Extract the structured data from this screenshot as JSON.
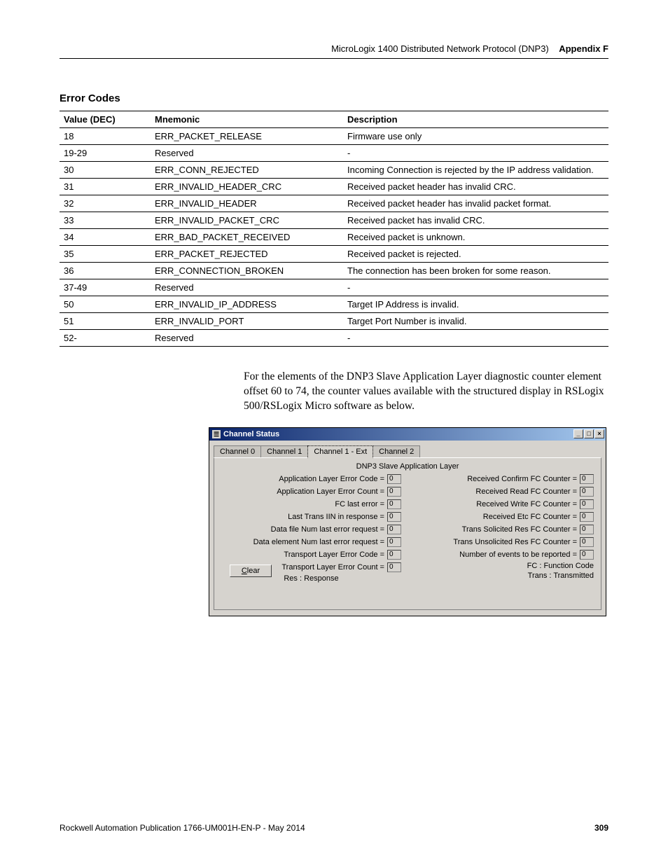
{
  "header": {
    "doc_title": "MicroLogix 1400 Distributed Network Protocol (DNP3)",
    "appendix": "Appendix F"
  },
  "section_title": "Error Codes",
  "table": {
    "headers": {
      "value": "Value (DEC)",
      "mnemonic": "Mnemonic",
      "description": "Description"
    },
    "rows": [
      {
        "value": "18",
        "mnemonic": "ERR_PACKET_RELEASE",
        "description": "Firmware use only"
      },
      {
        "value": "19-29",
        "mnemonic": "Reserved",
        "description": "-"
      },
      {
        "value": "30",
        "mnemonic": "ERR_CONN_REJECTED",
        "description": "Incoming Connection is rejected by the IP address validation."
      },
      {
        "value": "31",
        "mnemonic": "ERR_INVALID_HEADER_CRC",
        "description": "Received packet header has invalid CRC."
      },
      {
        "value": "32",
        "mnemonic": "ERR_INVALID_HEADER",
        "description": "Received packet header has invalid packet format."
      },
      {
        "value": "33",
        "mnemonic": "ERR_INVALID_PACKET_CRC",
        "description": "Received packet has invalid CRC."
      },
      {
        "value": "34",
        "mnemonic": "ERR_BAD_PACKET_RECEIVED",
        "description": "Received packet is unknown."
      },
      {
        "value": "35",
        "mnemonic": "ERR_PACKET_REJECTED",
        "description": "Received packet is rejected."
      },
      {
        "value": "36",
        "mnemonic": "ERR_CONNECTION_BROKEN",
        "description": "The connection has been broken for some reason."
      },
      {
        "value": "37-49",
        "mnemonic": "Reserved",
        "description": "-"
      },
      {
        "value": "50",
        "mnemonic": "ERR_INVALID_IP_ADDRESS",
        "description": "Target IP Address is invalid."
      },
      {
        "value": "51",
        "mnemonic": "ERR_INVALID_PORT",
        "description": "Target Port Number is invalid."
      },
      {
        "value": "52-",
        "mnemonic": "Reserved",
        "description": "-"
      }
    ]
  },
  "paragraph": "For the elements of the DNP3 Slave Application Layer diagnostic counter element offset 60 to 74, the counter values  available with the structured display in RSLogix 500/RSLogix Micro software as below.",
  "dialog": {
    "title": "Channel Status",
    "tabs": [
      "Channel 0",
      "Channel 1",
      "Channel 1 - Ext",
      "Channel 2"
    ],
    "active_tab_index": 2,
    "panel_title": "DNP3 Slave Application Layer",
    "left_rows": [
      {
        "label": "Application Layer Error Code =",
        "value": "0"
      },
      {
        "label": "Application Layer Error Count =",
        "value": "0"
      },
      {
        "label": "FC last error =",
        "value": "0"
      },
      {
        "label": "Last Trans IIN in response =",
        "value": "0"
      },
      {
        "label": "Data file Num last error request =",
        "value": "0"
      },
      {
        "label": "Data element Num last error request =",
        "value": "0"
      },
      {
        "label": "Transport Layer Error Code =",
        "value": "0"
      },
      {
        "label": "Transport Layer Error Count =",
        "value": "0"
      }
    ],
    "right_rows": [
      {
        "label": "Received Confirm FC Counter =",
        "value": "0"
      },
      {
        "label": "Received Read FC Counter =",
        "value": "0"
      },
      {
        "label": "Received Write FC Counter =",
        "value": "0"
      },
      {
        "label": "Received Etc FC Counter =",
        "value": "0"
      },
      {
        "label": "Trans Solicited Res FC Counter =",
        "value": "0"
      },
      {
        "label": "Trans Unsolicited Res FC Counter =",
        "value": "0"
      },
      {
        "label": "Number of events to be reported =",
        "value": "0"
      }
    ],
    "legend_right1": "FC : Function Code",
    "legend_right2": "Trans : Transmitted",
    "legend_left": "Res : Response",
    "clear_button": "Clear"
  },
  "footer": {
    "pub": "Rockwell Automation Publication 1766-UM001H-EN-P - May 2014",
    "page": "309"
  }
}
